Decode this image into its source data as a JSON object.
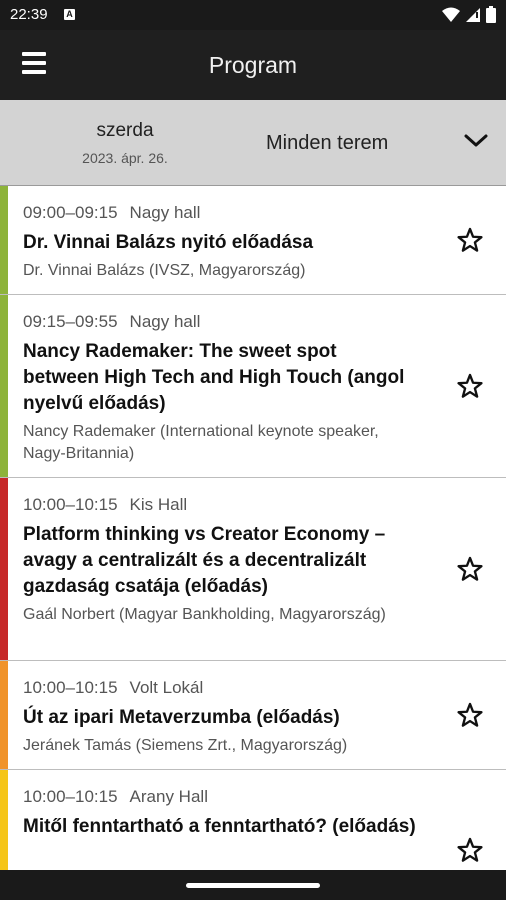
{
  "status_bar": {
    "time": "22:39",
    "badge": "A"
  },
  "app_bar": {
    "title": "Program",
    "menu_icon": "hamburger-menu-icon"
  },
  "filter": {
    "day": "szerda",
    "date": "2023. ápr. 26.",
    "room_select": "Minden terem",
    "dropdown_icon": "chevron-down-icon"
  },
  "sessions": [
    {
      "time": "09:00–09:15",
      "room": "Nagy hall",
      "title": "Dr. Vinnai Balázs nyitó előadása",
      "speaker": "Dr. Vinnai Balázs (IVSZ, Magyarország)",
      "color": "#8db33a"
    },
    {
      "time": "09:15–09:55",
      "room": "Nagy hall",
      "title": "Nancy Rademaker: The sweet spot between High Tech and High Touch (angol nyelvű előadás)",
      "speaker": "Nancy Rademaker (International keynote speaker, Nagy-Britannia)",
      "color": "#8db33a"
    },
    {
      "time": "10:00–10:15",
      "room": "Kis Hall",
      "title": "Platform thinking vs Creator Economy – avagy a centralizált és a decentralizált gazdaság csatája (előadás)",
      "speaker": "Gaál Norbert (Magyar Bankholding, Magyarország)",
      "color": "#c62828"
    },
    {
      "time": "10:00–10:15",
      "room": "Volt Lokál",
      "title": "Út az ipari Metaverzumba (előadás)",
      "speaker": "Jeránek Tamás (Siemens Zrt., Magyarország)",
      "color": "#f0932a"
    },
    {
      "time": "10:00–10:15",
      "room": "Arany Hall",
      "title": "Mitől fenntartható a fenntartható? (előadás)",
      "speaker": "",
      "color": "#f5c518"
    }
  ]
}
